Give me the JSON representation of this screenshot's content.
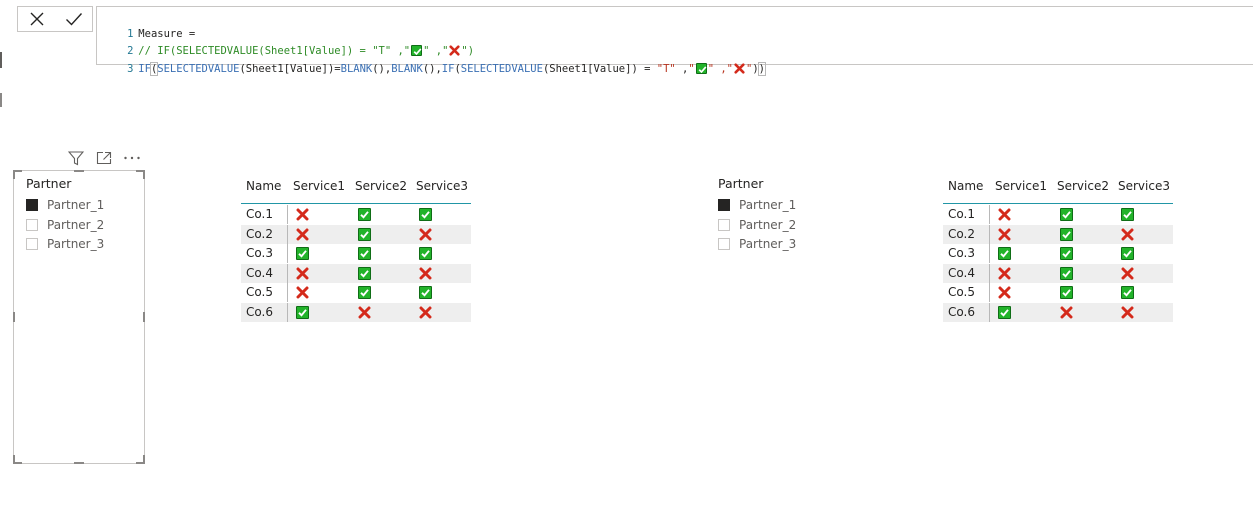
{
  "formula": {
    "line1": {
      "num": "1",
      "text": "Measure ="
    },
    "line2": {
      "num": "2",
      "prefix": "// IF(SELECTEDVALUE(Sheet1[Value]) = \"T\" ,\"",
      "mid": "\" ,\"",
      "suffix": "\")"
    },
    "line3": {
      "num": "3",
      "if1": "IF",
      "open1": "(",
      "sv1": "SELECTEDVALUE",
      "arg1": "(Sheet1[Value])=",
      "blank1": "BLANK",
      "sep1": "(),",
      "blank2": "BLANK",
      "sep2": "(),",
      "if2": "IF",
      "open2": "(",
      "sv2": "SELECTEDVALUE",
      "arg2": "(Sheet1[Value]) = ",
      "t": "\"T\"",
      "sp": " ,",
      "q1": "\"",
      "q2": "\" ,",
      "q3": "\"",
      "q4": "\"",
      "close1": ")",
      "close2": ")"
    }
  },
  "slicer_left": {
    "title": "Partner",
    "items": [
      {
        "label": "Partner_1",
        "checked": true
      },
      {
        "label": "Partner_2",
        "checked": false
      },
      {
        "label": "Partner_3",
        "checked": false
      }
    ]
  },
  "slicer_right": {
    "title": "Partner",
    "items": [
      {
        "label": "Partner_1",
        "checked": true
      },
      {
        "label": "Partner_2",
        "checked": false
      },
      {
        "label": "Partner_3",
        "checked": false
      }
    ]
  },
  "table": {
    "columns": [
      "Name",
      "Service1",
      "Service2",
      "Service3"
    ],
    "rows": [
      {
        "name": "Co.1",
        "values": [
          "x",
          "ok",
          "ok"
        ]
      },
      {
        "name": "Co.2",
        "values": [
          "x",
          "ok",
          "x"
        ]
      },
      {
        "name": "Co.3",
        "values": [
          "ok",
          "ok",
          "ok"
        ]
      },
      {
        "name": "Co.4",
        "values": [
          "x",
          "ok",
          "x"
        ]
      },
      {
        "name": "Co.5",
        "values": [
          "x",
          "ok",
          "ok"
        ]
      },
      {
        "name": "Co.6",
        "values": [
          "ok",
          "x",
          "x"
        ]
      }
    ]
  },
  "icons": {
    "cancel": "close-icon",
    "commit": "checkmark-icon",
    "filter": "filter-icon",
    "focus": "focus-mode-icon",
    "more": "more-options-icon",
    "ok": "check-mark-button-icon",
    "fail": "cross-mark-icon"
  },
  "colors": {
    "ok_fill": "#22b32a",
    "fail": "#d42a1b",
    "header_rule": "#2196a6",
    "alt_row": "#eeeeee",
    "checked": "#252423"
  }
}
